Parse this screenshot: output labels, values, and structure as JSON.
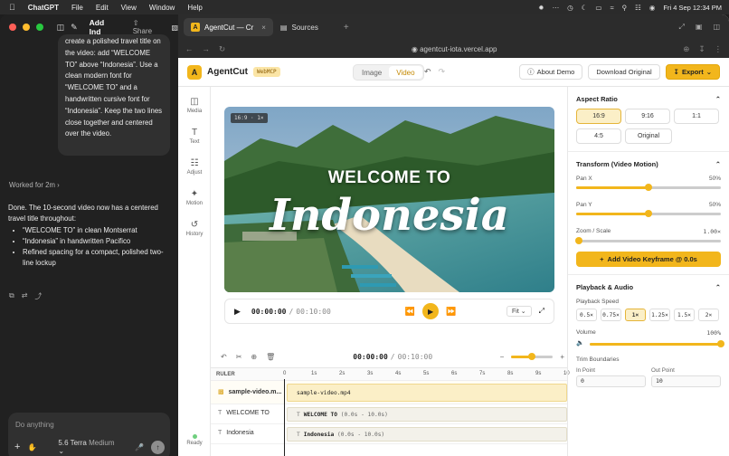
{
  "menubar": {
    "app": "ChatGPT",
    "items": [
      "File",
      "Edit",
      "View",
      "Window",
      "Help"
    ],
    "clock": "Fri 4 Sep  12:34 PM"
  },
  "chat": {
    "title": "Add Ind",
    "share": "Share",
    "bubble": "create a polished travel title on the video: add “WELCOME TO” above “Indonesia”. Use a clean modern font for “WELCOME TO” and a handwritten cursive font for “Indonesia”. Keep the two lines close together and centered over the video.",
    "worked": "Worked for 2m",
    "reply": "Done. The 10-second video now has a centered travel title throughout:",
    "bullets": [
      "“WELCOME TO” in clean Montserrat",
      "“Indonesia” in handwritten Pacifico",
      "Refined spacing for a compact, polished two-line lockup"
    ],
    "placeholder": "Do anything",
    "model": "5.6 Terra",
    "effort": "Medium"
  },
  "browser": {
    "tabs": [
      "AgentCut — Cr",
      "Sources"
    ],
    "url": "agentcut-iota.vercel.app"
  },
  "app": {
    "name": "AgentCut",
    "badge": "WebMCP",
    "modes": [
      "Image",
      "Video"
    ],
    "active_mode": "Video",
    "about": "About Demo",
    "download": "Download Original",
    "export": "Export",
    "sidebar": [
      "Media",
      "Text",
      "Adjust",
      "Motion",
      "History"
    ],
    "status": "Ready",
    "video": {
      "chip": "16:9 · 1×",
      "line1": "WELCOME TO",
      "line2": "Indonesia",
      "current": "00:00:00",
      "total": "00:10:00",
      "fit": "Fit"
    },
    "timeline": {
      "current": "00:00:00",
      "total": "00:10:00",
      "zoom": 0.5,
      "ruler": "RULER",
      "ticks": [
        "0",
        "1s",
        "2s",
        "3s",
        "4s",
        "5s",
        "6s",
        "7s",
        "8s",
        "9s",
        "10"
      ],
      "tracks": [
        {
          "label": "sample-video.m...",
          "clip": "sample-video.mp4"
        },
        {
          "label": "WELCOME TO",
          "clip_title": "WELCOME TO",
          "clip_range": "(0.0s - 10.0s)"
        },
        {
          "label": "Indonesia",
          "clip_title": "Indonesia",
          "clip_range": "(0.0s - 10.0s)"
        }
      ]
    },
    "panel": {
      "aspect_title": "Aspect Ratio",
      "ratios": [
        "16:9",
        "9:16",
        "1:1",
        "4:5",
        "Original"
      ],
      "ratio_selected": "16:9",
      "transform_title": "Transform (Video Motion)",
      "pan_x_label": "Pan X",
      "pan_x": "50%",
      "pan_y_label": "Pan Y",
      "pan_y": "50%",
      "zoom_label": "Zoom / Scale",
      "zoom": "1.00×",
      "keyframe_btn": "Add Video Keyframe @ 0.0s",
      "playback_title": "Playback & Audio",
      "speed_label": "Playback Speed",
      "speeds": [
        "0.5×",
        "0.75×",
        "1×",
        "1.25×",
        "1.5×",
        "2×"
      ],
      "speed_selected": "1×",
      "volume_label": "Volume",
      "volume": "100%",
      "trim_title": "Trim Boundaries",
      "in_label": "In Point",
      "in_value": "0",
      "out_label": "Out Point",
      "out_value": "10"
    }
  },
  "colors": {
    "accent": "#f2b61c",
    "accent_light": "#fbefc7"
  }
}
